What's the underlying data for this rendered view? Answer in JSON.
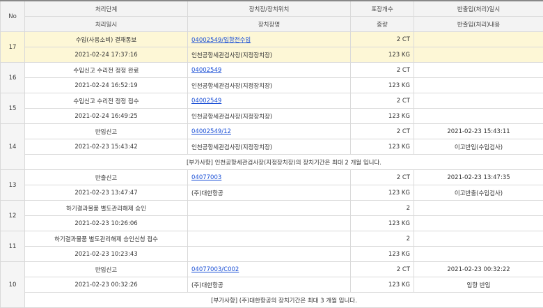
{
  "headers": {
    "no": "No",
    "stage": "처리단계",
    "location": "장치장/장치위치",
    "packages": "포장개수",
    "inout_date": "반출입(처리)일시",
    "proc_date": "처리일시",
    "location_name": "장치장명",
    "weight": "중량",
    "inout_detail": "반출입(처리)내용"
  },
  "rows": [
    {
      "no": "17",
      "highlight": true,
      "stage": "수입(사용소비) 결재통보",
      "date": "2021-02-24 17:37:16",
      "code": "04002549/입항전수입",
      "place": "인천공항세관검사장(지정장치장)",
      "pkg": "2 CT",
      "weight": "123 KG",
      "inout_date": "",
      "inout_detail": "",
      "note": ""
    },
    {
      "no": "16",
      "highlight": false,
      "stage": "수입신고 수리전 정정 완료",
      "date": "2021-02-24 16:52:19",
      "code": "04002549",
      "place": "인천공항세관검사장(지정장치장)",
      "pkg": "2 CT",
      "weight": "123 KG",
      "inout_date": "",
      "inout_detail": "",
      "note": ""
    },
    {
      "no": "15",
      "highlight": false,
      "stage": "수입신고 수리전 정정 접수",
      "date": "2021-02-24 16:49:25",
      "code": "04002549",
      "place": "인천공항세관검사장(지정장치장)",
      "pkg": "2 CT",
      "weight": "123 KG",
      "inout_date": "",
      "inout_detail": "",
      "note": ""
    },
    {
      "no": "14",
      "highlight": false,
      "stage": "반입신고",
      "date": "2021-02-23 15:43:42",
      "code": "04002549/12",
      "place": "인천공항세관검사장(지정장치장)",
      "pkg": "2 CT",
      "weight": "123 KG",
      "inout_date": "2021-02-23 15:43:11",
      "inout_detail": "이고반입(수입검사)",
      "note": "[부가사항] 인천공항세관검사장(지정장치장)의 장치기간은 최대 2 개월 입니다."
    },
    {
      "no": "13",
      "highlight": false,
      "stage": "반출신고",
      "date": "2021-02-23 13:47:47",
      "code": "04077003",
      "place": "(주)대한항공",
      "pkg": "2 CT",
      "weight": "123 KG",
      "inout_date": "2021-02-23 13:47:35",
      "inout_detail": "이고반출(수입검사)",
      "note": ""
    },
    {
      "no": "12",
      "highlight": false,
      "stage": "하기결과물품 별도관리해제 승인",
      "date": "2021-02-23 10:26:06",
      "code": "",
      "place": "",
      "pkg": "2",
      "weight": "123 KG",
      "inout_date": "",
      "inout_detail": "",
      "note": ""
    },
    {
      "no": "11",
      "highlight": false,
      "stage": "하기결과물품 별도관리해제 승인신청 접수",
      "date": "2021-02-23 10:23:43",
      "code": "",
      "place": "",
      "pkg": "2",
      "weight": "123 KG",
      "inout_date": "",
      "inout_detail": "",
      "note": ""
    },
    {
      "no": "10",
      "highlight": false,
      "stage": "반입신고",
      "date": "2021-02-23 00:32:26",
      "code": "04077003/C002",
      "place": "(주)대한항공",
      "pkg": "2 CT",
      "weight": "123 KG",
      "inout_date": "2021-02-23 00:32:22",
      "inout_detail": "입항 반입",
      "note": "[부가사항] (주)대한항공의 장치기간은 최대 3 개월 입니다."
    }
  ]
}
